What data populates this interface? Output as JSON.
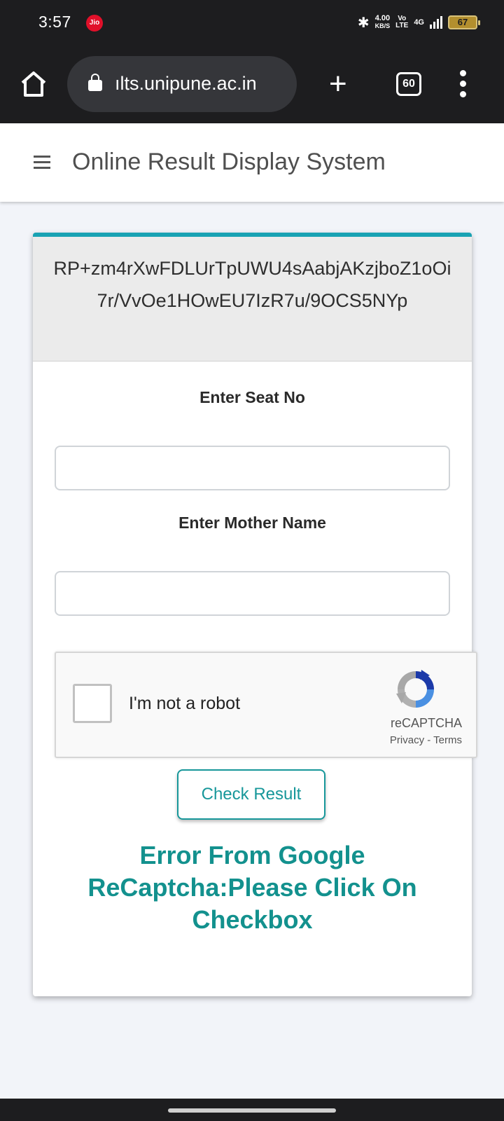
{
  "status_bar": {
    "time": "3:57",
    "carrier_badge": "Jio",
    "net_speed_value": "4.00",
    "net_speed_unit": "KB/S",
    "volte_top": "Vo",
    "volte_bottom": "LTE",
    "network_type": "4G",
    "battery": "67"
  },
  "browser": {
    "url": "ılts.unipune.ac.in",
    "tab_count": "60"
  },
  "header": {
    "title": "Online Result Display System"
  },
  "form": {
    "token": "RP+zm4rXwFDLUrTpUWU4sAabjAKzjboZ1oOi7r/VvOe1HOwEU7IzR7u/9OCS5NYp",
    "seat_label": "Enter Seat No",
    "mother_label": "Enter Mother Name",
    "recaptcha": {
      "label": "I'm not a robot",
      "brand": "reCAPTCHA",
      "privacy": "Privacy",
      "separator": " - ",
      "terms": "Terms"
    },
    "submit_label": "Check Result",
    "error": "Error From Google ReCaptcha:Please Click On Checkbox"
  },
  "colors": {
    "accent": "#19a2b3",
    "button_text": "#17979a",
    "error_text": "#13918e"
  }
}
